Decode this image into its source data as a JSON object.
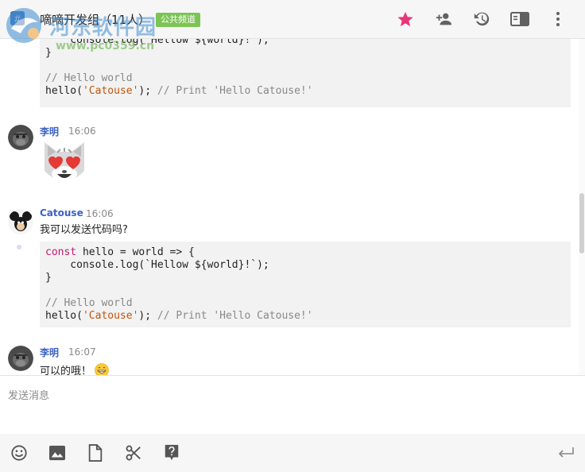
{
  "header": {
    "title": "嘀嘀开发组（11人）",
    "badge": "公共频道",
    "icons": [
      "star-icon",
      "add-person-icon",
      "history-icon",
      "sidebar-icon",
      "more-vert-icon"
    ],
    "accent_star_color": "#e8357a"
  },
  "watermark": {
    "line1": "河东软件园",
    "line2": "www.pc0359.cn"
  },
  "messages": {
    "code_top": {
      "line_console": "    console.log(`Hellow ${world}!`);",
      "line_close": "}",
      "line_comment": "// Hello world",
      "call_prefix": "hello(",
      "call_arg": "'Catouse'",
      "call_suffix": ");",
      "call_comment": " // Print 'Hello Catouse!'"
    },
    "msg1": {
      "author": "李明",
      "time": "16:06",
      "content_icon": "heart-eyes-cat-emoji"
    },
    "msg2": {
      "author": "Catouse",
      "time": "16:06",
      "text": "我可以发送代码吗?",
      "code": {
        "kw": "const",
        "line1_rest": " hello = world => {",
        "line_console": "    console.log(`Hellow ${world}!`);",
        "line_close": "}",
        "line_comment": "// Hello world",
        "call_prefix": "hello(",
        "call_arg": "'Catouse'",
        "call_suffix": ");",
        "call_comment": " // Print 'Hello Catouse!'"
      }
    },
    "msg3": {
      "author": "李明",
      "time": "16:07",
      "text": "可以的哦！",
      "emoji": "grin-emoji"
    }
  },
  "composer": {
    "placeholder": "发送消息"
  },
  "toolbar": {
    "icons": [
      "emoji-icon",
      "image-icon",
      "file-icon",
      "scissors-icon",
      "help-icon",
      "send-enter-icon"
    ]
  }
}
